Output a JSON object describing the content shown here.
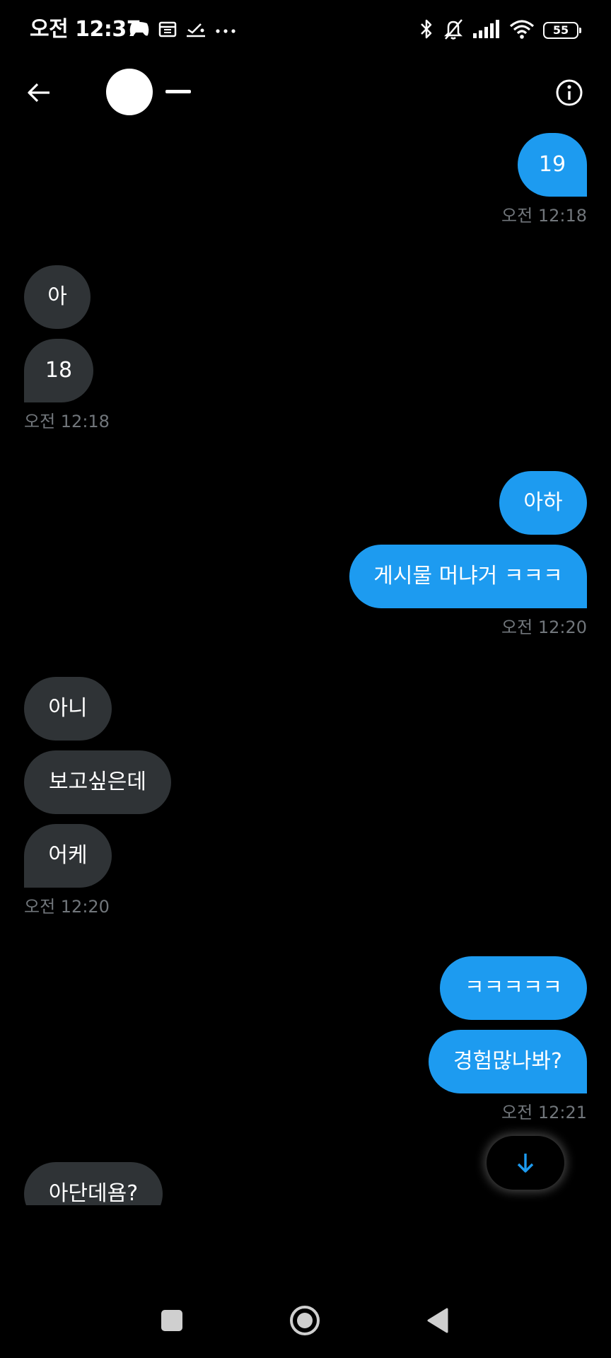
{
  "status_bar": {
    "time": "오전 12:37",
    "battery": "55",
    "left_icons": [
      "game-controller-icon",
      "calendar-icon",
      "sleep-icon",
      "more-dots-icon"
    ],
    "right_icons": [
      "bluetooth-icon",
      "bell-off-icon",
      "signal-icon",
      "wifi-icon",
      "battery-icon"
    ]
  },
  "header": {
    "back_icon": "arrow-left-icon",
    "info_icon": "info-icon"
  },
  "conversation": {
    "messages": [
      {
        "side": "sent",
        "text": "19"
      },
      {
        "side": "sent",
        "timestamp": "오전 12:18"
      },
      {
        "side": "recv",
        "text": "아"
      },
      {
        "side": "recv",
        "text": "18"
      },
      {
        "side": "recv",
        "timestamp": "오전 12:18"
      },
      {
        "side": "sent",
        "text": "아하"
      },
      {
        "side": "sent",
        "text": "게시물 머냐거 ㅋㅋㅋ"
      },
      {
        "side": "sent",
        "timestamp": "오전 12:20"
      },
      {
        "side": "recv",
        "text": "아니"
      },
      {
        "side": "recv",
        "text": "보고싶은데"
      },
      {
        "side": "recv",
        "text": "어케"
      },
      {
        "side": "recv",
        "timestamp": "오전 12:20"
      },
      {
        "side": "sent",
        "text": "ㅋㅋㅋㅋㅋ"
      },
      {
        "side": "sent",
        "text": "경험많나봐?"
      },
      {
        "side": "sent",
        "timestamp": "오전 12:21"
      },
      {
        "side": "recv",
        "text": "아단데욤?"
      }
    ]
  },
  "colors": {
    "background": "#000000",
    "sent_bubble": "#1d9bf0",
    "received_bubble": "#2f3336",
    "timestamp": "#71767b",
    "accent": "#1d9bf0"
  },
  "scroll_down_icon": "arrow-down-icon",
  "nav_bar": {
    "icons": [
      "recent-apps-icon",
      "home-icon",
      "back-triangle-icon"
    ]
  }
}
